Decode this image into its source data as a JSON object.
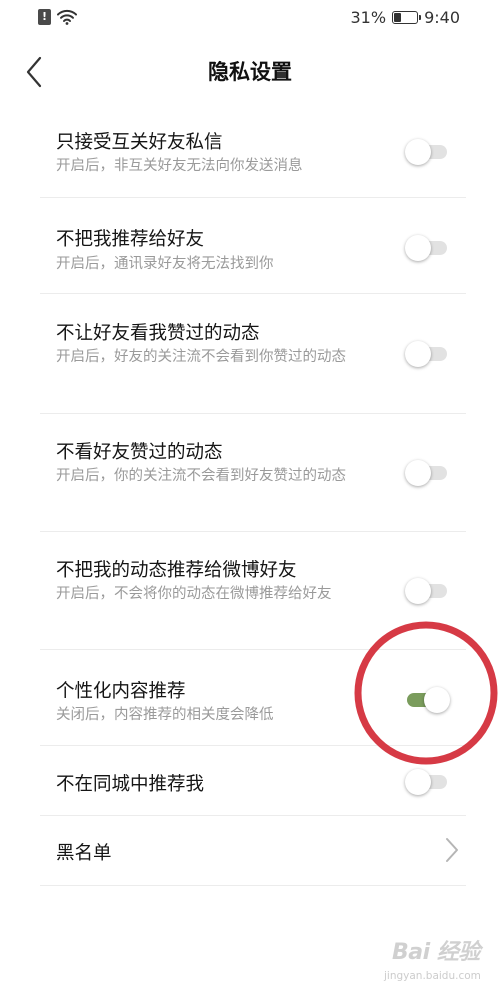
{
  "status_bar": {
    "alert_glyph": "!",
    "battery_percent": "31%",
    "battery_level": 0.31,
    "time": "9:40"
  },
  "header": {
    "back_icon": "chevron-left-icon",
    "title": "隐私设置"
  },
  "settings": [
    {
      "title": "只接受互关好友私信",
      "desc": "开启后，非互关好友无法向你发送消息",
      "enabled": false
    },
    {
      "title": "不把我推荐给好友",
      "desc": "开启后，通讯录好友将无法找到你",
      "enabled": false
    },
    {
      "title": "不让好友看我赞过的动态",
      "desc": "开启后，好友的关注流不会看到你赞过的动态",
      "enabled": false
    },
    {
      "title": "不看好友赞过的动态",
      "desc": "开启后，你的关注流不会看到好友赞过的动态",
      "enabled": false
    },
    {
      "title": "不把我的动态推荐给微博好友",
      "desc": "开启后，不会将你的动态在微博推荐给好友",
      "enabled": false
    },
    {
      "title": "个性化内容推荐",
      "desc": "关闭后，内容推荐的相关度会降低",
      "enabled": true
    },
    {
      "title": "不在同城中推荐我",
      "desc": "",
      "enabled": false
    }
  ],
  "blacklist": {
    "title": "黑名单",
    "icon": "chevron-right-icon"
  },
  "colors": {
    "toggle_on": "#7a9c5c",
    "toggle_off_track": "#e2e2e2",
    "annotation": "#d63a45"
  },
  "watermark": {
    "brand": "Bai 经验",
    "url": "jingyan.baidu.com"
  }
}
